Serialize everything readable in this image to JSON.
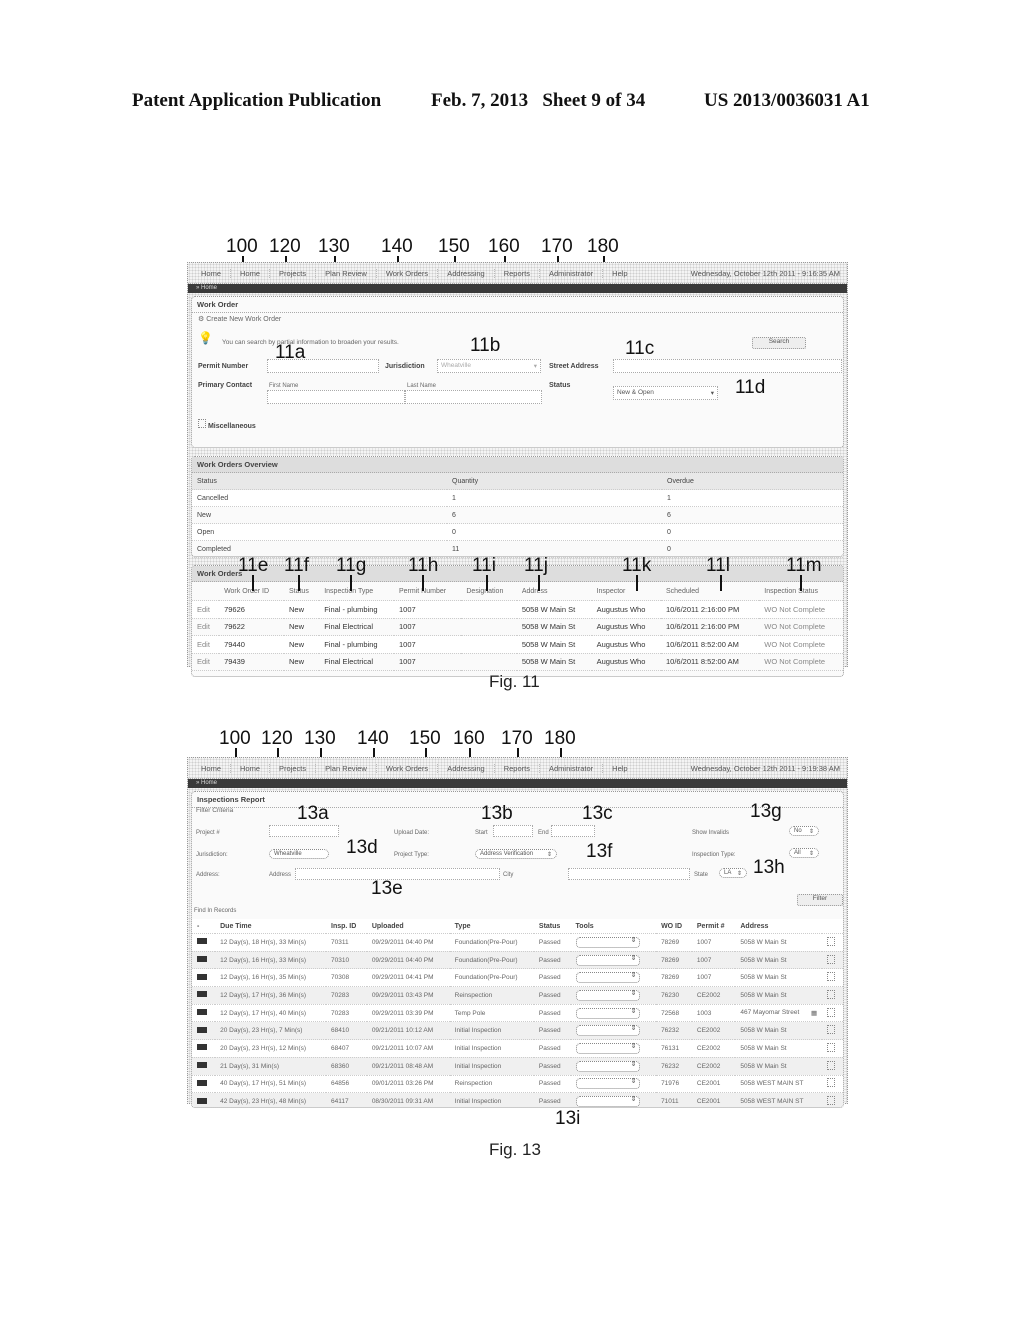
{
  "header": {
    "left": "Patent Application Publication",
    "middle": "Feb. 7, 2013   Sheet 9 of 34",
    "right": "US 2013/0036031 A1"
  },
  "fig11": {
    "caption": "Fig. 11",
    "refs": {
      "nav": [
        "100",
        "120",
        "130",
        "140",
        "150",
        "160",
        "170",
        "180"
      ],
      "a": "11a",
      "b": "11b",
      "c": "11c",
      "d": "11d",
      "cols": [
        "11e",
        "11f",
        "11g",
        "11h",
        "11i",
        "11j",
        "11k",
        "11l",
        "11m"
      ]
    },
    "nav": {
      "items": [
        "Home",
        "Home",
        "Projects",
        "Plan Review",
        "Work Orders",
        "Addressing",
        "Reports",
        "Administrator",
        "Help"
      ],
      "datetime": "Wednesday, October 12th 2011 - 9:16:35 AM"
    },
    "breadcrumb": "» Home",
    "work_order": {
      "title": "Work Order",
      "create_link": "Create New Work Order",
      "hint": "You can search by partial information to broaden your results.",
      "search_button": "Search",
      "permit_label": "Permit Number",
      "permit_value": "",
      "jurisdiction_label": "Jurisdiction",
      "jurisdiction_value": "Wheatville",
      "street_label": "Street Address",
      "street_value": "",
      "contact_label": "Primary Contact",
      "first_name_label": "First Name",
      "last_name_label": "Last Name",
      "status_label": "Status",
      "status_value": "New & Open",
      "misc_label": "Miscellaneous"
    },
    "overview": {
      "title": "Work Orders Overview",
      "columns": [
        "Status",
        "Quantity",
        "Overdue"
      ],
      "rows": [
        [
          "Cancelled",
          "1",
          "1"
        ],
        [
          "New",
          "6",
          "6"
        ],
        [
          "Open",
          "0",
          "0"
        ],
        [
          "Completed",
          "11",
          "0"
        ]
      ]
    },
    "work_orders": {
      "title": "Work Orders",
      "columns": [
        "",
        "Work Order ID",
        "Status",
        "Inspection Type",
        "Permit Number",
        "Designation",
        "Address",
        "Inspector",
        "Scheduled",
        "Inspection Status"
      ],
      "rows": [
        [
          "Edit",
          "79626",
          "New",
          "Final - plumbing",
          "1007",
          "",
          "5058 W Main St",
          "Augustus Who",
          "10/6/2011 2:16:00 PM",
          "WO Not Complete"
        ],
        [
          "Edit",
          "79622",
          "New",
          "Final Electrical",
          "1007",
          "",
          "5058 W Main St",
          "Augustus Who",
          "10/6/2011 2:16:00 PM",
          "WO Not Complete"
        ],
        [
          "Edit",
          "79440",
          "New",
          "Final - plumbing",
          "1007",
          "",
          "5058 W Main St",
          "Augustus Who",
          "10/6/2011 8:52:00 AM",
          "WO Not Complete"
        ],
        [
          "Edit",
          "79439",
          "New",
          "Final Electrical",
          "1007",
          "",
          "5058 W Main St",
          "Augustus Who",
          "10/6/2011 8:52:00 AM",
          "WO Not Complete"
        ]
      ]
    }
  },
  "fig13": {
    "caption": "Fig. 13",
    "refs": {
      "nav": [
        "100",
        "120",
        "130",
        "140",
        "150",
        "160",
        "170",
        "180"
      ],
      "a": "13a",
      "b": "13b",
      "c": "13c",
      "d": "13d",
      "e": "13e",
      "f": "13f",
      "g": "13g",
      "h": "13h",
      "i": "13i"
    },
    "nav": {
      "items": [
        "Home",
        "Home",
        "Projects",
        "Plan Review",
        "Work Orders",
        "Addressing",
        "Reports",
        "Administrator",
        "Help"
      ],
      "datetime": "Wednesday, October 12th 2011 - 9:19:38 AM"
    },
    "breadcrumb": "» Home",
    "report": {
      "title": "Inspections Report",
      "filter_label": "Filter Criteria",
      "project_label": "Project #",
      "project_value": "",
      "upload_label": "Upload Date:",
      "start_label": "Start",
      "start_value": "",
      "end_label": "End",
      "end_value": "",
      "show_label": "Show Invalids",
      "show_value": "No",
      "jurisdiction_label": "Jurisdiction:",
      "jurisdiction_value": "Wheatville",
      "project_type_label": "Project Type:",
      "project_type_value": "Address Verification",
      "insp_type_label": "Inspection Type:",
      "insp_type_value": "All",
      "address_label": "Address:",
      "address_inner_label": "Address",
      "address_value": "",
      "city_label": "City",
      "city_value": "",
      "state_label": "State",
      "state_value": "LA",
      "filter_button": "Filter",
      "records_label": "Find In Records"
    },
    "table": {
      "columns": [
        "-",
        "Due Time",
        "Insp. ID",
        "Uploaded",
        "Type",
        "Status",
        "Tools",
        "WO ID",
        "Permit #",
        "Address",
        ""
      ],
      "rows": [
        [
          "12 Day(s), 18 Hr(s), 33 Min(s)",
          "70311",
          "09/29/2011 04:40 PM",
          "Foundation(Pre-Pour)",
          "Passed",
          "78269",
          "1007",
          "5058 W Main St",
          false
        ],
        [
          "12 Day(s), 16 Hr(s), 33 Min(s)",
          "70310",
          "09/29/2011 04:40 PM",
          "Foundation(Pre-Pour)",
          "Passed",
          "78269",
          "1007",
          "5058 W Main St",
          false
        ],
        [
          "12 Day(s), 16 Hr(s), 35 Min(s)",
          "70308",
          "09/29/2011 04:41 PM",
          "Foundation(Pre-Pour)",
          "Passed",
          "78269",
          "1007",
          "5058 W Main St",
          false
        ],
        [
          "12 Day(s), 17 Hr(s), 36 Min(s)",
          "70283",
          "09/29/2011 03:43 PM",
          "Reinspection",
          "Passed",
          "76230",
          "CE2002",
          "5058 W Main St",
          false
        ],
        [
          "12 Day(s), 17 Hr(s), 40 Min(s)",
          "70283",
          "09/29/2011 03:39 PM",
          "Temp Pole",
          "Passed",
          "72568",
          "1003",
          "467 Mayomar Street",
          true
        ],
        [
          "20 Day(s), 23 Hr(s), 7 Min(s)",
          "68410",
          "09/21/2011 10:12 AM",
          "Initial Inspection",
          "Passed",
          "76232",
          "CE2002",
          "5058 W Main St",
          false
        ],
        [
          "20 Day(s), 23 Hr(s), 12 Min(s)",
          "68407",
          "09/21/2011 10:07 AM",
          "Initial Inspection",
          "Passed",
          "76131",
          "CE2002",
          "5058 W Main St",
          false
        ],
        [
          "21 Day(s), 31 Min(s)",
          "68360",
          "09/21/2011 08:48 AM",
          "Initial Inspection",
          "Passed",
          "76232",
          "CE2002",
          "5058 W Main St",
          false
        ],
        [
          "40 Day(s), 17 Hr(s), 51 Min(s)",
          "64856",
          "09/01/2011 03:26 PM",
          "Reinspection",
          "Passed",
          "71976",
          "CE2001",
          "5058 WEST MAIN ST",
          false
        ],
        [
          "42 Day(s), 23 Hr(s), 48 Min(s)",
          "64117",
          "08/30/2011 09:31 AM",
          "Initial Inspection",
          "Passed",
          "71011",
          "CE2001",
          "5058 WEST MAIN ST",
          false
        ]
      ]
    }
  }
}
